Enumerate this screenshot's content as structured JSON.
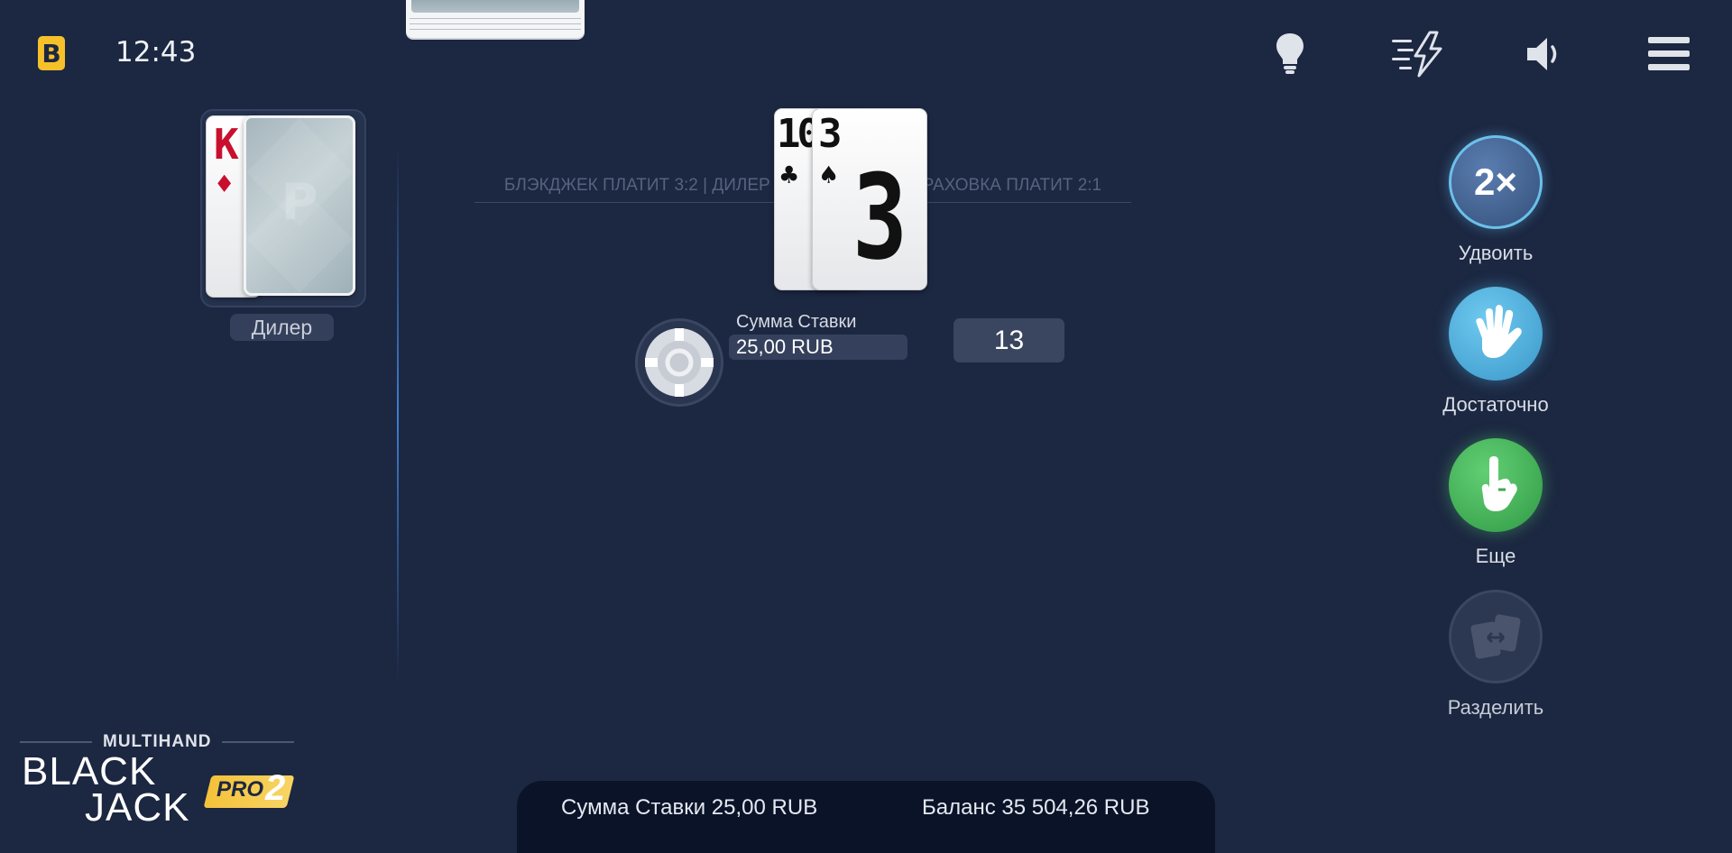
{
  "header": {
    "brand_letter": "B",
    "time": "12:43",
    "icons": [
      "lightbulb-icon",
      "turbo-icon",
      "speaker-icon",
      "menu-icon"
    ]
  },
  "rules_banner": "БЛЭКДЖЕК ПЛАТИТ 3:2 | ДИЛЕР ПОЛУЧАЕТ ... | СТРАХОВКА ПЛАТИТ 2:1",
  "dealer": {
    "label": "Дилер",
    "up_card": {
      "rank": "K",
      "suit": "♦",
      "color": "#c8102e"
    }
  },
  "player": {
    "cards": [
      {
        "rank": "10",
        "suit": "♣"
      },
      {
        "rank": "3",
        "suit": "♠"
      }
    ],
    "total": "13",
    "bet_caption": "Сумма Ставки",
    "bet_value": "25,00 RUB"
  },
  "actions": [
    {
      "key": "double",
      "label": "Удвоить",
      "symbol": "2×",
      "color": "#3d5a85",
      "enabled": true
    },
    {
      "key": "stand",
      "label": "Достаточно",
      "color": "#47a9d6",
      "enabled": true
    },
    {
      "key": "hit",
      "label": "Еще",
      "color": "#3aa853",
      "enabled": true
    },
    {
      "key": "split",
      "label": "Разделить",
      "color": "#33405a",
      "enabled": false
    }
  ],
  "footer": {
    "bet": "Сумма Ставки 25,00 RUB",
    "balance": "Баланс 35 504,26 RUB"
  },
  "game_logo": {
    "line1": "MULTIHAND",
    "line2": "BLACK",
    "line3": "JACK",
    "badge": "PRO",
    "version": "2"
  }
}
